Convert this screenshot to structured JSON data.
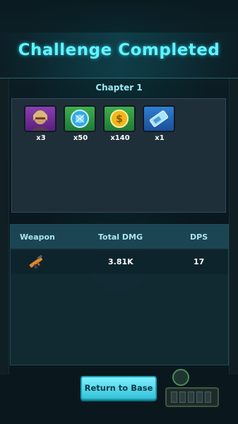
{
  "screen": {
    "title": "Challenge Completed",
    "chapter": "Chapter 1"
  },
  "rewards": [
    {
      "icon": "character-portrait-icon",
      "qty": "x3",
      "color": "#8b3fb0"
    },
    {
      "icon": "blue-orb-icon",
      "qty": "x50",
      "color": "#3fae4e"
    },
    {
      "icon": "gold-coin-icon",
      "qty": "x140",
      "color": "#3fae4e"
    },
    {
      "icon": "ticket-icon",
      "qty": "x1",
      "color": "#2f7fd1"
    }
  ],
  "stats": {
    "headers": {
      "weapon": "Weapon",
      "total_dmg": "Total DMG",
      "dps": "DPS"
    },
    "rows": [
      {
        "weapon_icon": "rifle-icon",
        "total_dmg": "3.81K",
        "dps": "17"
      }
    ]
  },
  "actions": {
    "return_label": "Return to Base"
  },
  "colors": {
    "title": "#5ff4ff",
    "accent": "#36c2d8"
  }
}
